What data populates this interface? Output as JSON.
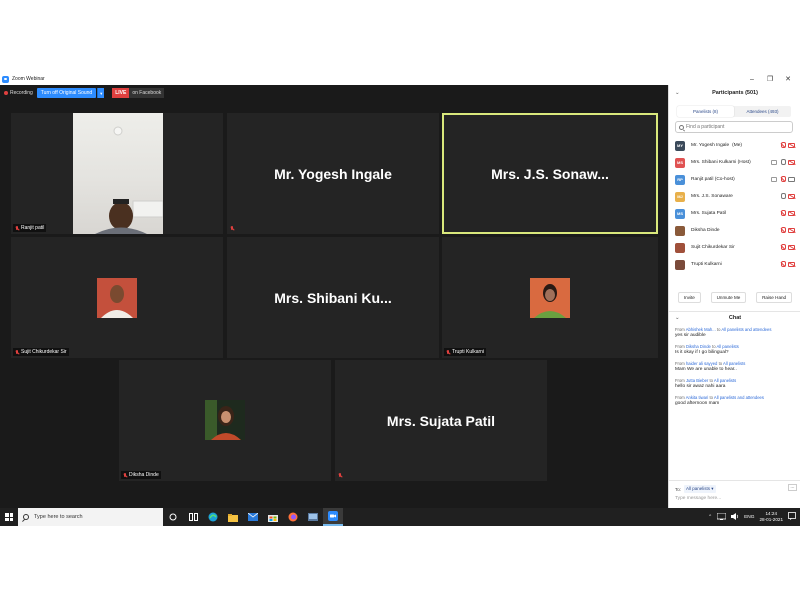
{
  "window": {
    "title": "Zoom Webinar"
  },
  "toolbar": {
    "recording_label": "Recording",
    "sound_button": "Turn off Original Sound",
    "live_badge": "LIVE",
    "live_destination": "on Facebook"
  },
  "tiles": [
    {
      "name_tag": "Ranjit patil",
      "display_name": ""
    },
    {
      "name_tag": "",
      "display_name": "Mr. Yogesh Ingale"
    },
    {
      "name_tag": "",
      "display_name": "Mrs. J.S. Sonaw..."
    },
    {
      "name_tag": "Sujit Chikurdekar Sir",
      "display_name": ""
    },
    {
      "name_tag": "",
      "display_name": "Mrs. Shibani Ku..."
    },
    {
      "name_tag": "Trupti Kulkarni",
      "display_name": ""
    },
    {
      "name_tag": "Diksha Dinde",
      "display_name": ""
    },
    {
      "name_tag": "",
      "display_name": "Mrs. Sujata Patil"
    }
  ],
  "participants_panel": {
    "title": "Participants (501)",
    "tab_panelists": "Panelists (8)",
    "tab_attendees": "Attendees (493)",
    "search_placeholder": "Find a participant",
    "list": [
      {
        "initials": "MY",
        "name": "Mr. Yogesh Ingale",
        "suffix": "(Me)",
        "color": "#3b4a5a"
      },
      {
        "initials": "MS",
        "name": "Mrs. Shibani Kulkarni (Host)",
        "suffix": "",
        "color": "#e05252"
      },
      {
        "initials": "RP",
        "name": "Ranjit patil (Co-host)",
        "suffix": "",
        "color": "#4a90d9"
      },
      {
        "initials": "MJ",
        "name": "Mrs. J.S. Sonaware",
        "suffix": "",
        "color": "#e8b04a"
      },
      {
        "initials": "MS",
        "name": "Mrs. Sujata Patil",
        "suffix": "",
        "color": "#4a90d9"
      },
      {
        "initials": "",
        "name": "Diksha Dinde",
        "suffix": "",
        "color": "#8a5a3a"
      },
      {
        "initials": "",
        "name": "Sujit Chikurdekar Sir",
        "suffix": "",
        "color": "#a0503a"
      },
      {
        "initials": "",
        "name": "Trupti Kulkarni",
        "suffix": "",
        "color": "#7a4a3a"
      }
    ],
    "invite": "Invite",
    "unmute_me": "Unmute Me",
    "raise_hand": "Raise Hand"
  },
  "chat": {
    "title": "Chat",
    "messages": [
      {
        "from_label": "From",
        "sender": "Abhishek Mah...",
        "to_label": "to",
        "recipient": "All panelists and attendees",
        "text": "yes sir audible"
      },
      {
        "from_label": "From",
        "sender": "Diksha Dinde",
        "to_label": "to",
        "recipient": "All panelists",
        "text": "Is it okay if I go bilingual?"
      },
      {
        "from_label": "From",
        "sender": "haider ali sayyed",
        "to_label": "to",
        "recipient": "All panelists",
        "text": "Mam We are unable to hear.."
      },
      {
        "from_label": "From",
        "sender": "Jutta Bieber",
        "to_label": "to",
        "recipient": "All panelists",
        "text": "hello sir awaz nahi aara"
      },
      {
        "from_label": "From",
        "sender": "Ankita tiwari",
        "to_label": "to",
        "recipient": "All panelists and attendees",
        "text": "good afternoon mam"
      }
    ],
    "to_label": "To:",
    "to_value": "All panelists",
    "more": "...",
    "input_placeholder": "Type message here..."
  },
  "taskbar": {
    "search_placeholder": "Type here to search",
    "language": "ENG",
    "time": "14:24",
    "date": "28-01-2021"
  }
}
